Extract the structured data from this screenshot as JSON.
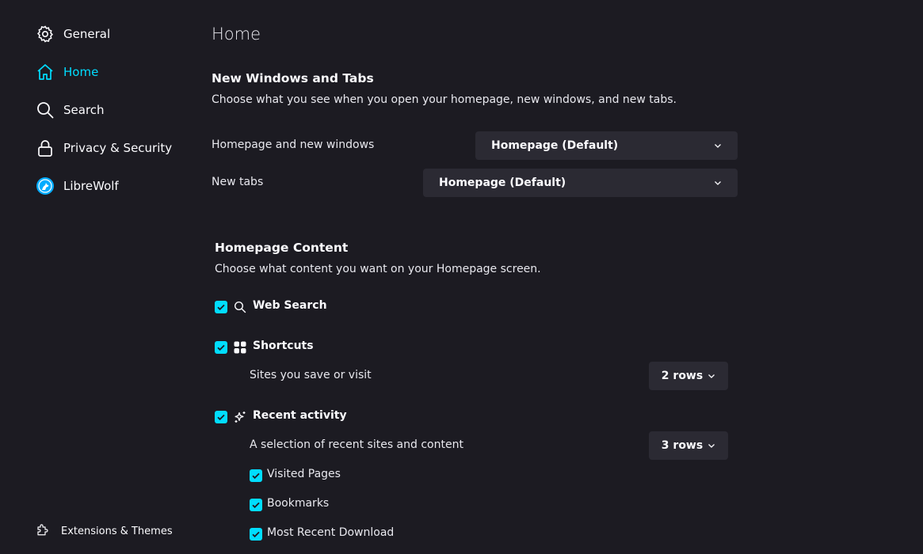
{
  "sidebar": {
    "items": [
      {
        "label": "General",
        "icon": "gear-icon"
      },
      {
        "label": "Home",
        "icon": "home-icon",
        "active": true
      },
      {
        "label": "Search",
        "icon": "search-icon"
      },
      {
        "label": "Privacy & Security",
        "icon": "lock-icon"
      },
      {
        "label": "LibreWolf",
        "icon": "librewolf-icon"
      }
    ],
    "bottom_link": {
      "label": "Extensions & Themes",
      "icon": "puzzle-icon"
    }
  },
  "main": {
    "title": "Home",
    "new_windows": {
      "heading": "New Windows and Tabs",
      "description": "Choose what you see when you open your homepage, new windows, and new tabs.",
      "homepage_label": "Homepage and new windows",
      "homepage_value": "Homepage (Default)",
      "newtabs_label": "New tabs",
      "newtabs_value": "Homepage (Default)"
    },
    "content": {
      "heading": "Homepage Content",
      "description": "Choose what content you want on your Homepage screen.",
      "web_search": "Web Search",
      "shortcuts": "Shortcuts",
      "shortcuts_desc": "Sites you save or visit",
      "shortcuts_rows": "2 rows",
      "recent": "Recent activity",
      "recent_desc": "A selection of recent sites and content",
      "recent_rows": "3 rows",
      "visited": "Visited Pages",
      "bookmarks": "Bookmarks",
      "download": "Most Recent Download"
    }
  },
  "colors": {
    "accent": "#00ddff",
    "background": "#1c1b22",
    "control": "#2b2a33"
  }
}
